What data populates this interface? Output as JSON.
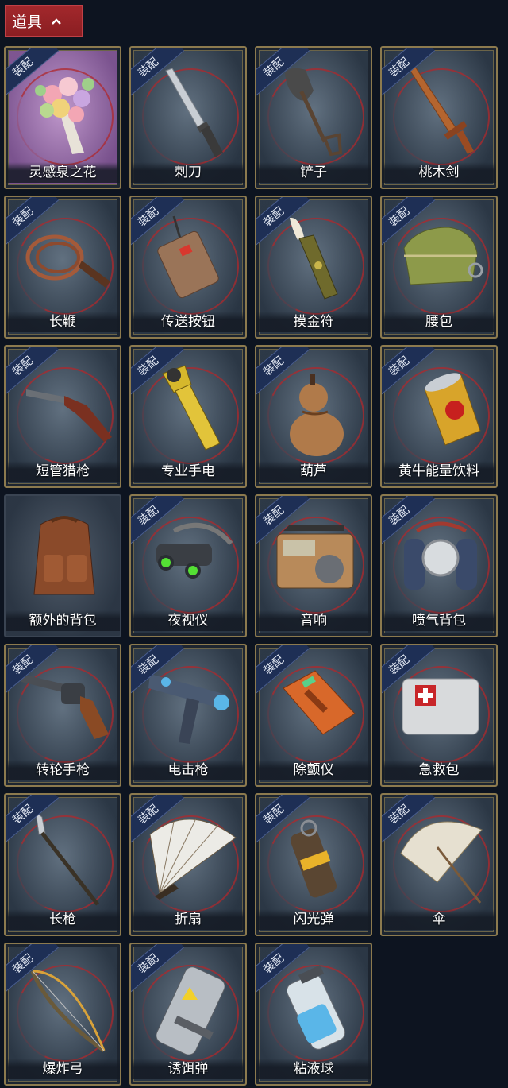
{
  "section": {
    "title": "道具"
  },
  "badge_label": "装配",
  "items": [
    {
      "name": "灵感泉之花",
      "equipped": true
    },
    {
      "name": "刺刀",
      "equipped": true
    },
    {
      "name": "铲子",
      "equipped": true
    },
    {
      "name": "桃木剑",
      "equipped": true
    },
    {
      "name": "长鞭",
      "equipped": true
    },
    {
      "name": "传送按钮",
      "equipped": true
    },
    {
      "name": "摸金符",
      "equipped": true
    },
    {
      "name": "腰包",
      "equipped": true
    },
    {
      "name": "短管猎枪",
      "equipped": true
    },
    {
      "name": "专业手电",
      "equipped": true
    },
    {
      "name": "葫芦",
      "equipped": true
    },
    {
      "name": "黄牛能量饮料",
      "equipped": true
    },
    {
      "name": "额外的背包",
      "equipped": false
    },
    {
      "name": "夜视仪",
      "equipped": true
    },
    {
      "name": "音响",
      "equipped": true
    },
    {
      "name": "喷气背包",
      "equipped": true
    },
    {
      "name": "转轮手枪",
      "equipped": true
    },
    {
      "name": "电击枪",
      "equipped": true
    },
    {
      "name": "除颤仪",
      "equipped": true
    },
    {
      "name": "急救包",
      "equipped": true
    },
    {
      "name": "长枪",
      "equipped": true
    },
    {
      "name": "折扇",
      "equipped": true
    },
    {
      "name": "闪光弹",
      "equipped": true
    },
    {
      "name": "伞",
      "equipped": true
    },
    {
      "name": "爆炸弓",
      "equipped": true
    },
    {
      "name": "诱饵弹",
      "equipped": true
    },
    {
      "name": "粘液球",
      "equipped": true
    }
  ]
}
